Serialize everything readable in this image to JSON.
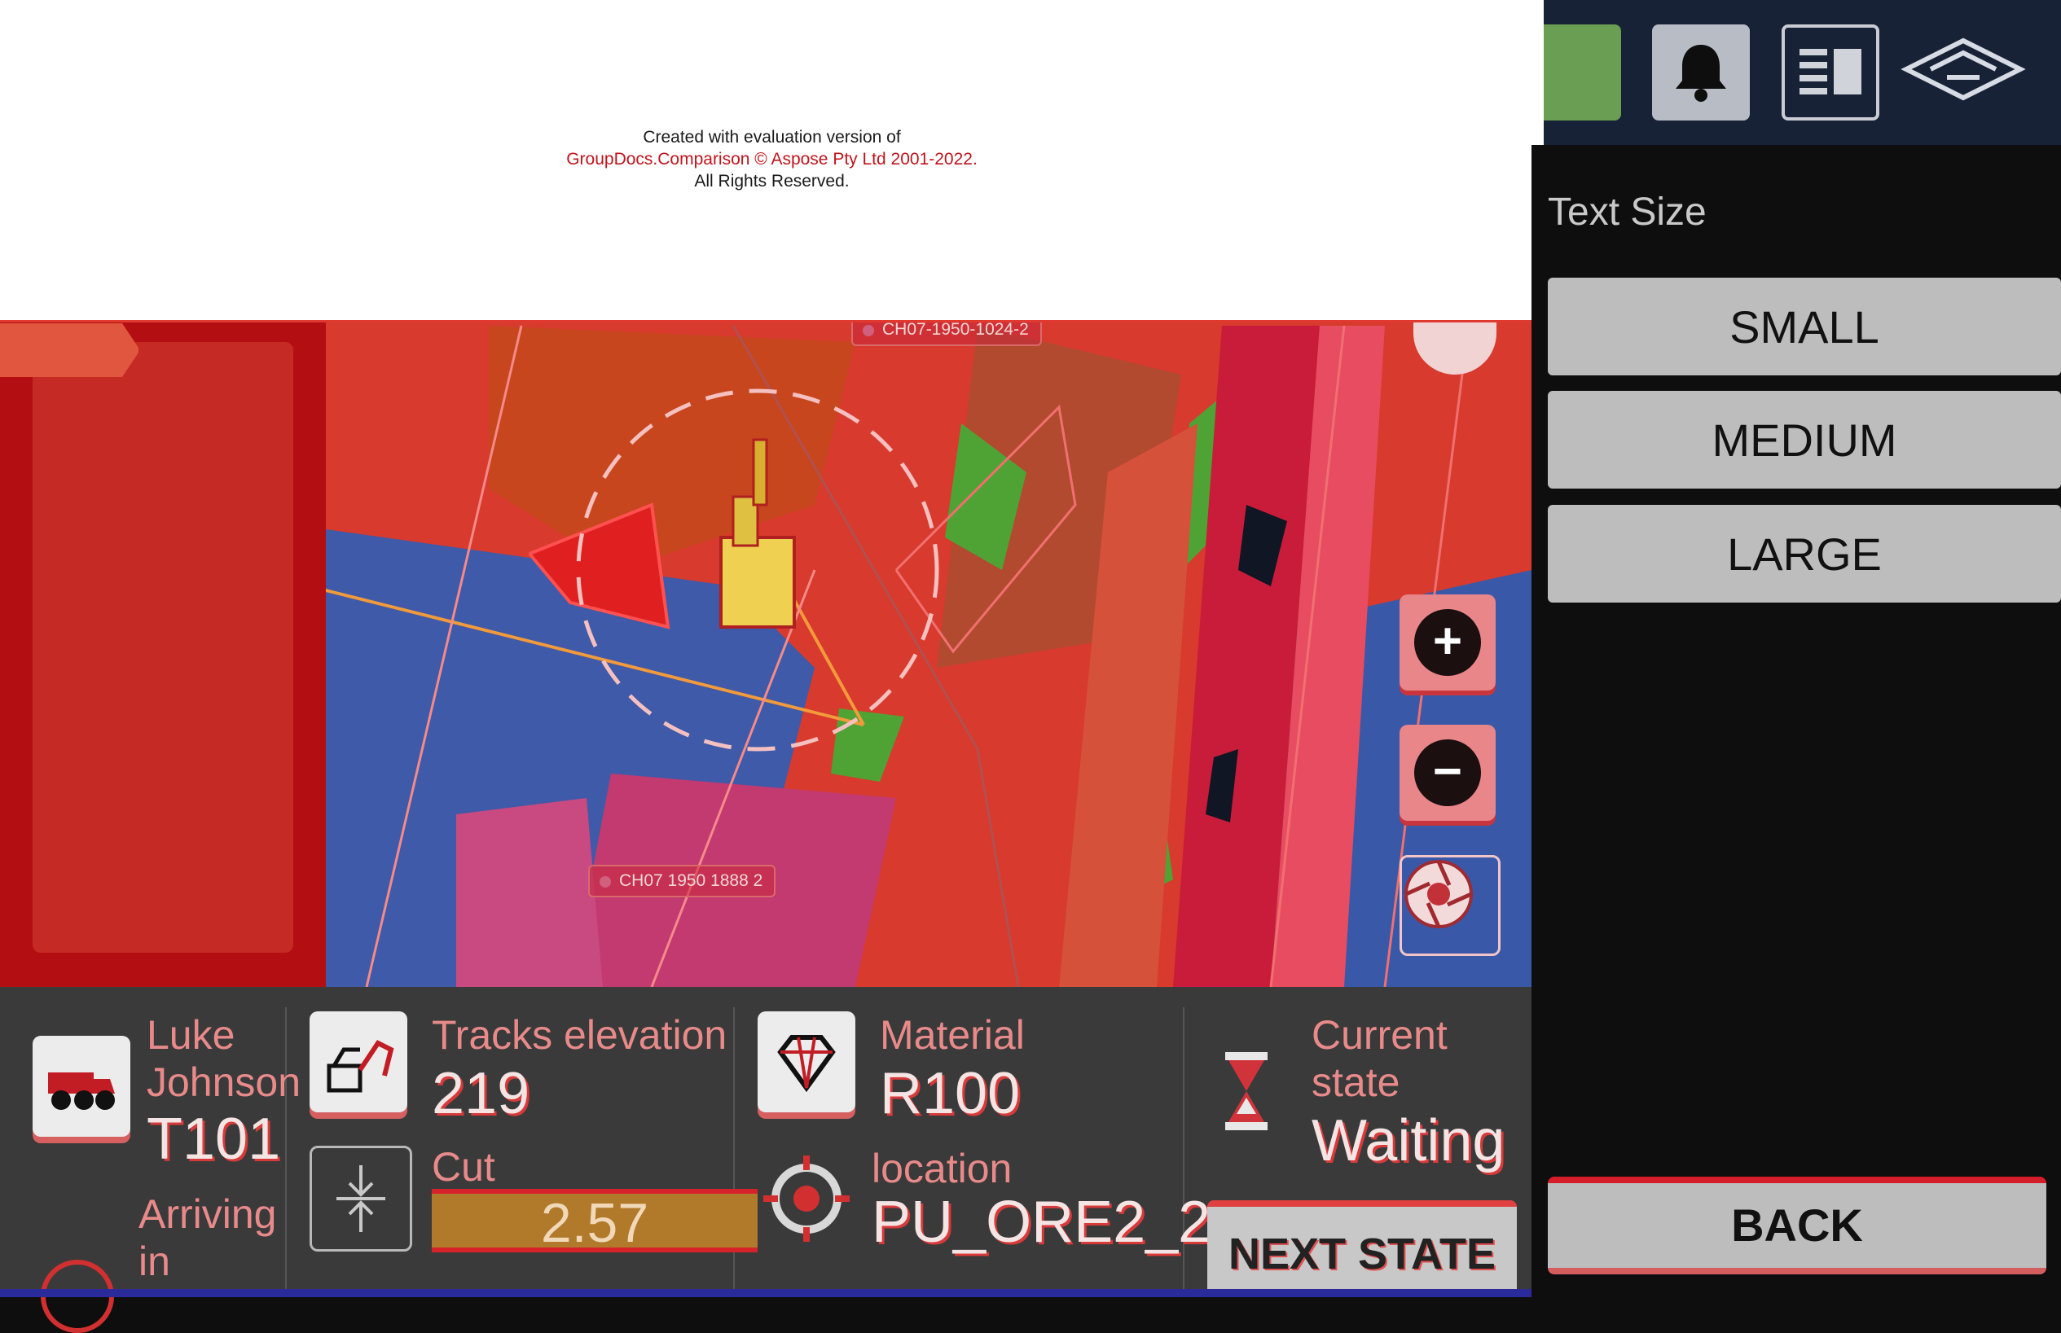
{
  "watermark": {
    "line1": "Created with evaluation version of",
    "line2": "GroupDocs.Comparison © Aspose Pty Ltd 2001-2022.",
    "line3": "All Rights Reserved."
  },
  "map": {
    "label_top": "CH07-1950-1024-2",
    "label_bottom": "CH07 1950 1888 2",
    "zoom_in_icon": "zoom-in-icon",
    "zoom_out_icon": "zoom-out-icon",
    "camera_icon": "camera-aperture-icon",
    "compass_icon": "compass-icon"
  },
  "header": {
    "notifications_icon": "bell-icon",
    "layout_icon": "layout-icon",
    "logo_icon": "brand-logo-icon",
    "status_color": "#6a9e52"
  },
  "text_size": {
    "title": "Text Size",
    "options": [
      "SMALL",
      "MEDIUM",
      "LARGE"
    ],
    "back_label": "BACK"
  },
  "bottom": {
    "operator": {
      "name_line1": "Luke",
      "name_line2": "Johnson",
      "truck_id": "T101",
      "arriving_line1": "Arriving",
      "arriving_line2": "in"
    },
    "tracks": {
      "label": "Tracks elevation",
      "value": "219"
    },
    "cut": {
      "label": "Cut",
      "value": "2.57"
    },
    "material": {
      "label": "Material",
      "value": "R100"
    },
    "location": {
      "label": "location",
      "value": "PU_ORE2_2"
    },
    "state": {
      "label_line1": "Current",
      "label_line2": "state",
      "value": "Waiting",
      "next_label": "NEXT STATE"
    }
  },
  "colors": {
    "accent_red": "#d6232a",
    "panel_bg": "#3a3a3a",
    "sidebar_bg": "#0e0e0e",
    "header_bg": "#172236"
  }
}
